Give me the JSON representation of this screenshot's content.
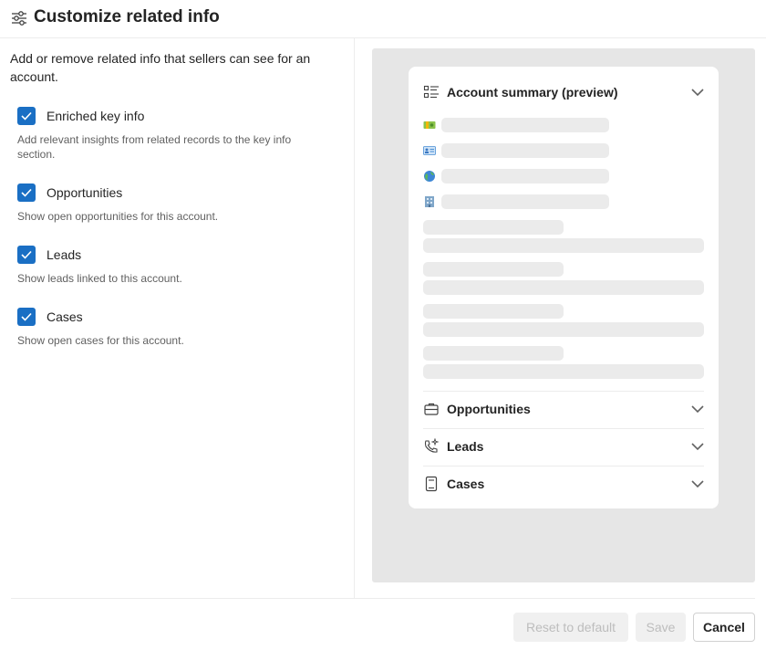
{
  "header": {
    "title": "Customize related info",
    "icon": "settings-sliders-icon"
  },
  "intro_text": "Add or remove related info that sellers can see for an account.",
  "options": [
    {
      "label": "Enriched key info",
      "description": "Add relevant insights from related records to the key info section.",
      "checked": true
    },
    {
      "label": "Opportunities",
      "description": "Show open opportunities for this account.",
      "checked": true
    },
    {
      "label": "Leads",
      "description": "Show leads linked to this account.",
      "checked": true
    },
    {
      "label": "Cases",
      "description": "Show open cases for this account.",
      "checked": true
    }
  ],
  "preview": {
    "sections": [
      {
        "title": "Account summary (preview)",
        "icon": "list-details-icon"
      },
      {
        "title": "Opportunities",
        "icon": "briefcase-icon"
      },
      {
        "title": "Leads",
        "icon": "phone-sparkle-icon"
      },
      {
        "title": "Cases",
        "icon": "document-icon"
      }
    ],
    "summary_row_icons": [
      "money-icon",
      "contact-card-icon",
      "globe-icon",
      "building-icon"
    ]
  },
  "footer": {
    "reset_label": "Reset to default",
    "save_label": "Save",
    "cancel_label": "Cancel"
  },
  "colors": {
    "accent": "#1a6fc4",
    "preview_background": "#e6e6e6"
  }
}
